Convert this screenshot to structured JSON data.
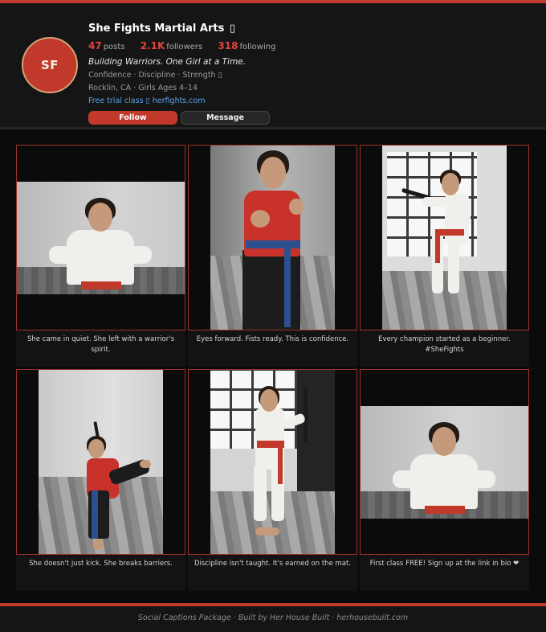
{
  "profile": {
    "avatar_initials": "SF",
    "name": "She Fights Martial Arts",
    "name_glyph": "▯",
    "stats": {
      "posts_count": "47",
      "posts_label": "posts",
      "followers_count": "2.1K",
      "followers_label": "followers",
      "following_count": "318",
      "following_label": "following"
    },
    "bio_tagline": "Building Warriors. One Girl at a Time.",
    "bio_values": "Confidence · Discipline · Strength ▯",
    "bio_location": "Rocklin, CA · Girls Ages 4–14",
    "bio_link": "Free trial class ▯ herfights.com",
    "follow_label": "Follow",
    "message_label": "Message"
  },
  "posts": [
    {
      "caption": "She came in quiet. She left with a warrior's spirit."
    },
    {
      "caption": "Eyes forward. Fists ready. This is confidence."
    },
    {
      "caption": "Every champion started as a beginner. #SheFights"
    },
    {
      "caption": "She doesn't just kick. She breaks barriers."
    },
    {
      "caption": "Discipline isn't taught. It's earned on the mat."
    },
    {
      "caption": "First class FREE! Sign up at the link in bio ❤"
    }
  ],
  "footer": {
    "text": "Social Captions Package · Built by Her House Built · herhousebuilt.com"
  },
  "colors": {
    "accent": "#c0392b",
    "link": "#5aa3e8",
    "background": "#0b0b0b"
  }
}
